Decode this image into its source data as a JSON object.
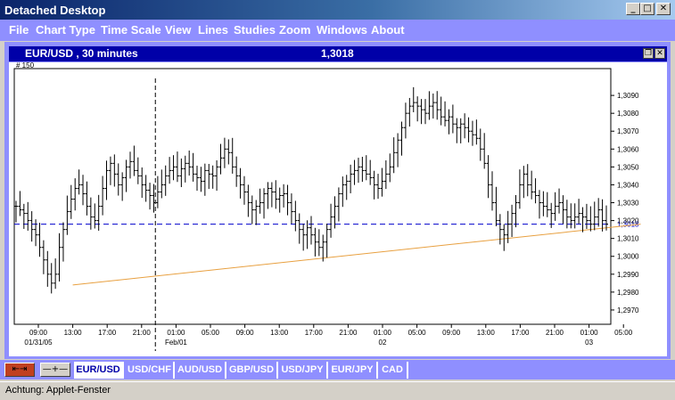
{
  "window": {
    "title": "Detached Desktop",
    "minimize": "_",
    "maximize": "□",
    "close": "✕"
  },
  "menu": [
    "File",
    "Chart Type",
    "Time Scale",
    "View",
    "Lines",
    "Studies",
    "Zoom",
    "Windows",
    "About"
  ],
  "panel": {
    "symbol": "EUR/USD , 30 minutes",
    "price": "1,3018",
    "restore": "❐",
    "close": "✕"
  },
  "chart_data": {
    "type": "ohlc",
    "corner_label": "# 150",
    "current_price": 1.3018,
    "current_price_label": "1,3018",
    "ylim": [
      1.2962,
      1.3105
    ],
    "y_ticks": [
      1.297,
      1.298,
      1.299,
      1.3,
      1.301,
      1.302,
      1.303,
      1.304,
      1.305,
      1.306,
      1.307,
      1.308,
      1.309
    ],
    "y_tick_labels": [
      "1,2970",
      "1,2980",
      "1,2990",
      "1,3000",
      "1,3010",
      "1,3020",
      "1,3030",
      "1,3040",
      "1,3050",
      "1,3060",
      "1,3070",
      "1,3080",
      "1,3090"
    ],
    "x_tick_labels": [
      "09:00",
      "13:00",
      "17:00",
      "21:00",
      "01:00",
      "05:00",
      "09:00",
      "13:00",
      "17:00",
      "21:00",
      "01:00",
      "05:00",
      "09:00",
      "13:00",
      "17:00",
      "21:00",
      "01:00",
      "05:00"
    ],
    "date_labels": [
      {
        "tick_index": 0,
        "text": "01/31/05"
      },
      {
        "tick_index": 4,
        "text": "Feb/01"
      },
      {
        "tick_index": 10,
        "text": "02"
      },
      {
        "tick_index": 16,
        "text": "03"
      }
    ],
    "trendline": {
      "start": [
        1,
        1.2984
      ],
      "end": [
        17.5,
        1.3018
      ]
    },
    "crosshair_x": 3.4,
    "closes": [
      1.3028,
      1.3026,
      1.3024,
      1.302,
      1.3015,
      1.3012,
      1.3005,
      1.2998,
      1.299,
      1.2985,
      1.299,
      1.3005,
      1.3015,
      1.3025,
      1.3032,
      1.3038,
      1.304,
      1.3035,
      1.3028,
      1.3022,
      1.302,
      1.3028,
      1.3038,
      1.3048,
      1.3052,
      1.3046,
      1.304,
      1.3044,
      1.305,
      1.3053,
      1.3048,
      1.3045,
      1.304,
      1.3037,
      1.3034,
      1.303,
      1.3036,
      1.304,
      1.3045,
      1.3048,
      1.305,
      1.3045,
      1.3049,
      1.3052,
      1.305,
      1.3046,
      1.3044,
      1.3042,
      1.3048,
      1.3046,
      1.3045,
      1.305,
      1.3055,
      1.306,
      1.3058,
      1.305,
      1.3045,
      1.304,
      1.3036,
      1.303,
      1.3026,
      1.3028,
      1.303,
      1.3035,
      1.3038,
      1.3036,
      1.3032,
      1.3034,
      1.3035,
      1.303,
      1.3025,
      1.302,
      1.3015,
      1.3012,
      1.3016,
      1.3012,
      1.3008,
      1.3005,
      1.3008,
      1.3015,
      1.3022,
      1.3028,
      1.3035,
      1.304,
      1.3042,
      1.3046,
      1.3048,
      1.305,
      1.3048,
      1.3046,
      1.3044,
      1.304,
      1.3038,
      1.3042,
      1.3046,
      1.305,
      1.3058,
      1.3065,
      1.3072,
      1.308,
      1.3084,
      1.3086,
      1.3084,
      1.3082,
      1.308,
      1.3084,
      1.3086,
      1.3082,
      1.3078,
      1.3076,
      1.3078,
      1.3074,
      1.3072,
      1.3074,
      1.3072,
      1.307,
      1.3068,
      1.3066,
      1.306,
      1.3052,
      1.304,
      1.303,
      1.302,
      1.3015,
      1.3012,
      1.3018,
      1.3024,
      1.303,
      1.304,
      1.3046,
      1.304,
      1.3036,
      1.3034,
      1.303,
      1.3028,
      1.3026,
      1.3024,
      1.3028,
      1.303,
      1.3026,
      1.3022,
      1.302,
      1.3022,
      1.3024,
      1.3022,
      1.302,
      1.3018,
      1.3022,
      1.3026,
      1.302,
      1.3018
    ]
  },
  "toolbar": {
    "cursor_tool": "⇤⇥",
    "crosshair_tool": "—+—"
  },
  "tabs": [
    "EUR/USD",
    "USD/CHF",
    "AUD/USD",
    "GBP/USD",
    "USD/JPY",
    "EUR/JPY",
    "CAD"
  ],
  "status": {
    "text": "Achtung: Applet-Fenster"
  }
}
